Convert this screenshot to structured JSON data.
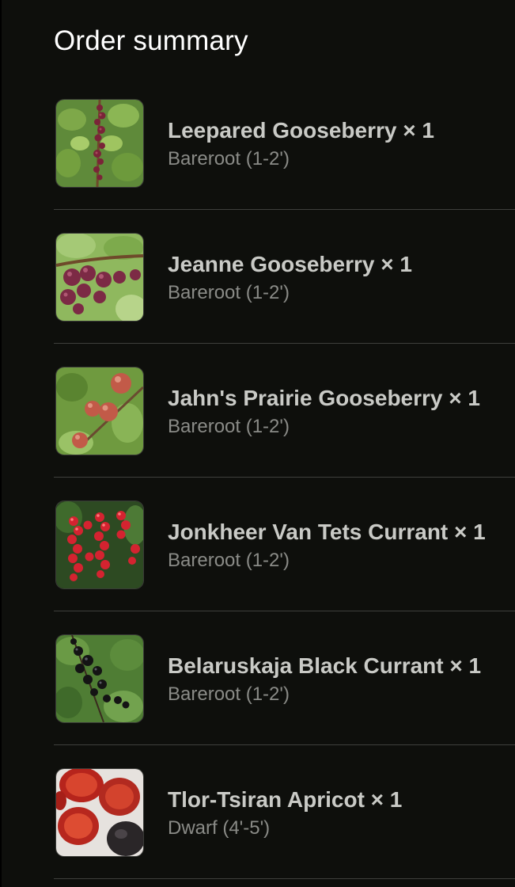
{
  "order_summary": {
    "title": "Order summary",
    "items": [
      {
        "name": "Leepared Gooseberry × 1",
        "variant": "Bareroot (1-2')",
        "image": "gooseberry-branch-photo"
      },
      {
        "name": "Jeanne Gooseberry × 1",
        "variant": "Bareroot (1-2')",
        "image": "red-gooseberry-cluster-photo"
      },
      {
        "name": "Jahn's Prairie Gooseberry × 1",
        "variant": "Bareroot (1-2')",
        "image": "pink-gooseberry-photo"
      },
      {
        "name": "Jonkheer Van Tets Currant × 1",
        "variant": "Bareroot (1-2')",
        "image": "red-currant-photo"
      },
      {
        "name": "Belaruskaja Black Currant × 1",
        "variant": "Bareroot (1-2')",
        "image": "black-currant-photo"
      },
      {
        "name": "Tlor-Tsiran Apricot × 1",
        "variant": "Dwarf (4'-5')",
        "image": "apricot-halves-photo"
      }
    ]
  }
}
